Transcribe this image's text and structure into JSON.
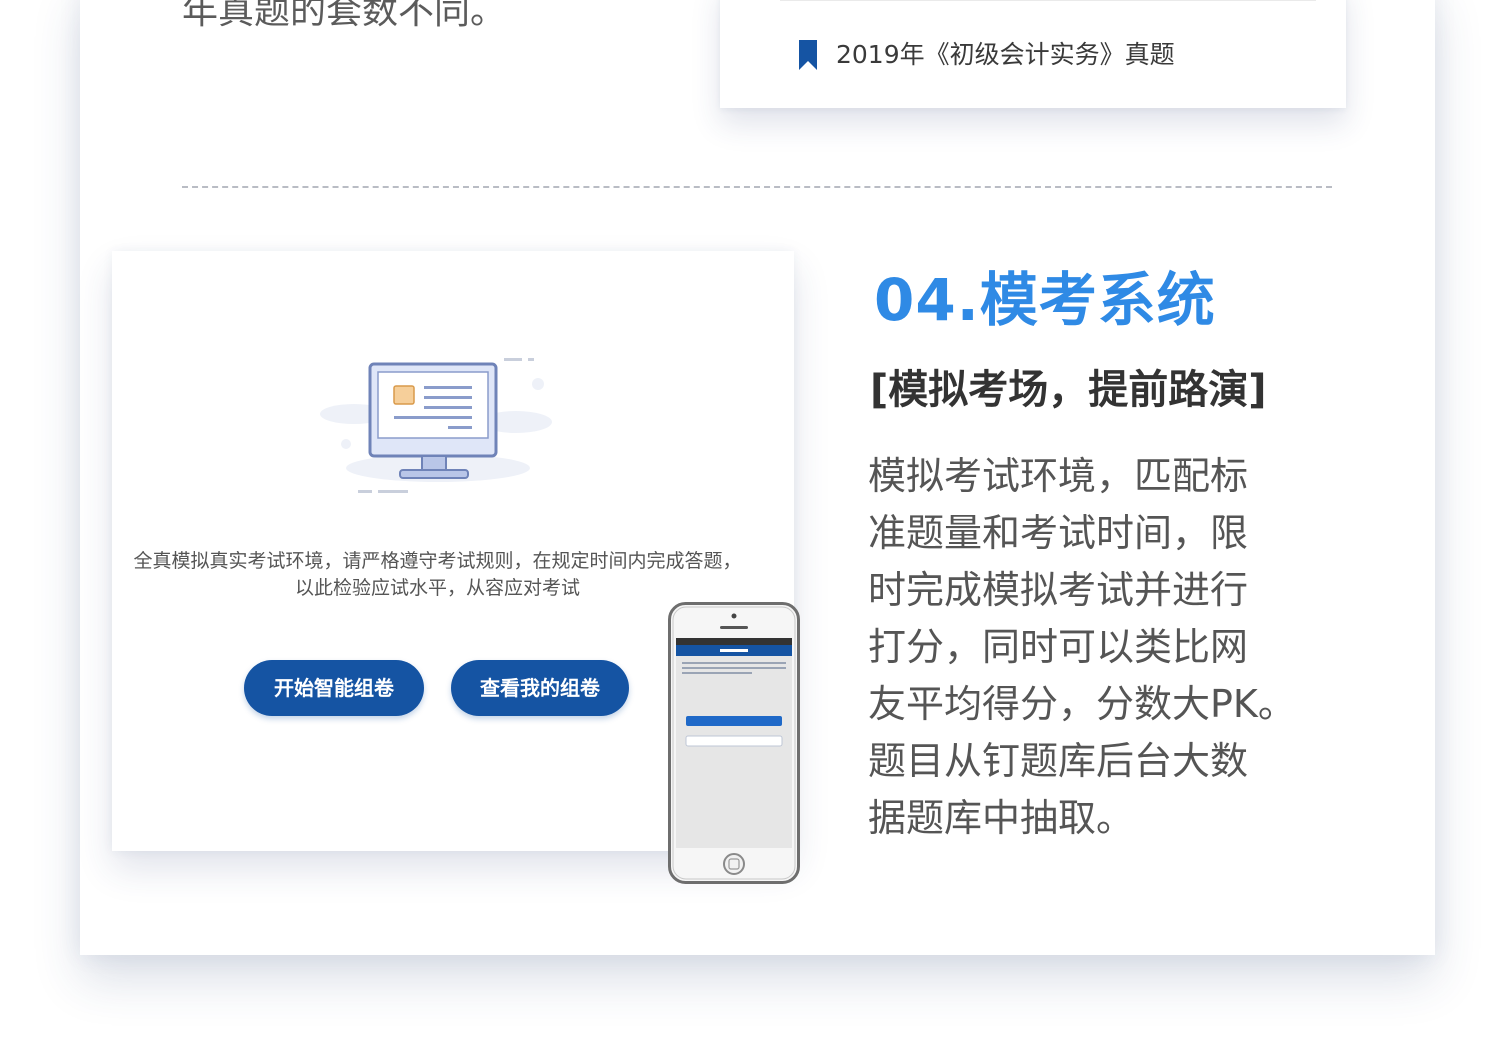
{
  "previous_section": {
    "text_tail": "年真题的套数不同。"
  },
  "reference_card": {
    "label": "2019年《初级会计实务》真题",
    "icon": "bookmark-icon",
    "icon_color": "#1554a3"
  },
  "mock_panel": {
    "illustration_icon": "monitor-icon",
    "description": "全真模拟真实考试环境，请严格遵守考试规则，在规定时间内完成答题，以此检验应试水平，从容应对考试",
    "buttons": {
      "start": "开始智能组卷",
      "view": "查看我的组卷"
    },
    "button_color": "#1554a3",
    "phone_icon": "smartphone-icon"
  },
  "section": {
    "title": "04.模考系统",
    "subtitle": "[模拟考场，提前路演]",
    "body_lines": [
      "模拟考试环境，匹配标",
      "准题量和考试时间，限",
      "时完成模拟考试并进行",
      "打分，同时可以类比网",
      "友平均得分，分数大PK。",
      "题目从钉题库后台大数",
      "据题库中抽取。"
    ],
    "title_color": "#2f8ae5"
  }
}
